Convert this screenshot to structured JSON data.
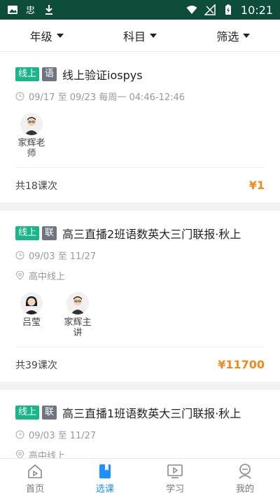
{
  "status": {
    "time": "10:21"
  },
  "filters": [
    {
      "label": "年级"
    },
    {
      "label": "科目"
    },
    {
      "label": "筛选"
    }
  ],
  "courses": [
    {
      "tag_mode": "线上",
      "tag_subject": "语",
      "title": "线上验证iospys",
      "schedule": "09/17 至 09/23 每周一 04:46-12:46",
      "location": "",
      "teachers": [
        {
          "name": "家辉老\n师"
        }
      ],
      "lesson_count": "共18课次",
      "price": "¥1"
    },
    {
      "tag_mode": "线上",
      "tag_subject": "联",
      "title": "高三直播2班语数英大三门联报·秋上",
      "schedule": "09/03 至 11/27",
      "location": "高中线上",
      "teachers": [
        {
          "name": "吕莹"
        },
        {
          "name": "家辉主\n讲"
        }
      ],
      "lesson_count": "共39课次",
      "price": "¥11700"
    },
    {
      "tag_mode": "线上",
      "tag_subject": "联",
      "title": "高三直播1班语数英大三门联报·秋上",
      "schedule": "09/03 至 11/27",
      "location": "高中线上",
      "teachers": [],
      "lesson_count": "",
      "price": ""
    }
  ],
  "tabs": [
    {
      "label": "首页",
      "active": false
    },
    {
      "label": "选课",
      "active": true
    },
    {
      "label": "学习",
      "active": false
    },
    {
      "label": "我的",
      "active": false
    }
  ],
  "colors": {
    "accent": "#1bb58a",
    "price": "#f08a1d",
    "tab_active": "#1e90ff",
    "statusbar": "#0d4b3a"
  }
}
